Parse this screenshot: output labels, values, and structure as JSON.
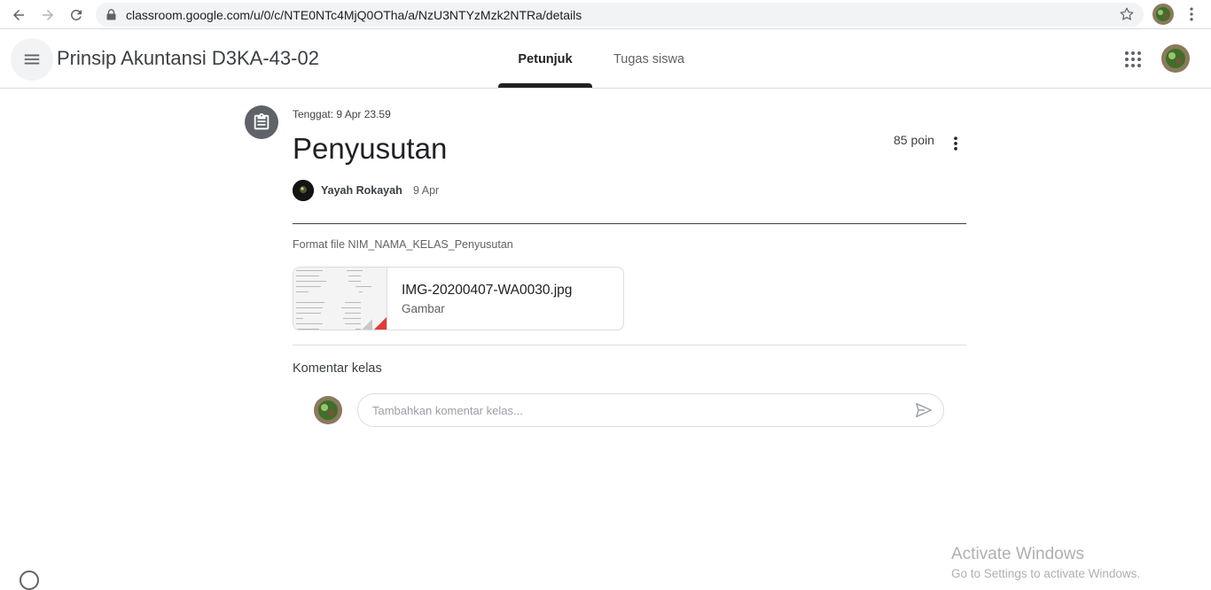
{
  "browser": {
    "url": "classroom.google.com/u/0/c/NTE0NTc4MjQ0OTha/a/NzU3NTYzMzk2NTRa/details"
  },
  "header": {
    "course_title": "Prinsip Akuntansi D3KA-43-02",
    "tabs": [
      {
        "label": "Petunjuk",
        "active": true
      },
      {
        "label": "Tugas siswa",
        "active": false
      }
    ]
  },
  "assignment": {
    "due": "Tenggat: 9 Apr 23.59",
    "title": "Penyusutan",
    "points": "85 poin",
    "author": "Yayah Rokayah",
    "posted_date": "9 Apr",
    "description": "Format file NIM_NAMA_KELAS_Penyusutan",
    "attachment": {
      "file_name": "IMG-20200407-WA0030.jpg",
      "file_type": "Gambar"
    }
  },
  "comments": {
    "title": "Komentar kelas",
    "placeholder": "Tambahkan komentar kelas..."
  },
  "watermark": {
    "line1": "Activate Windows",
    "line2": "Go to Settings to activate Windows."
  },
  "colors": {
    "accent": "#202124",
    "divider": "#dadce0",
    "icon_grey": "#5f6368",
    "thumb_corner": "#e53935"
  }
}
